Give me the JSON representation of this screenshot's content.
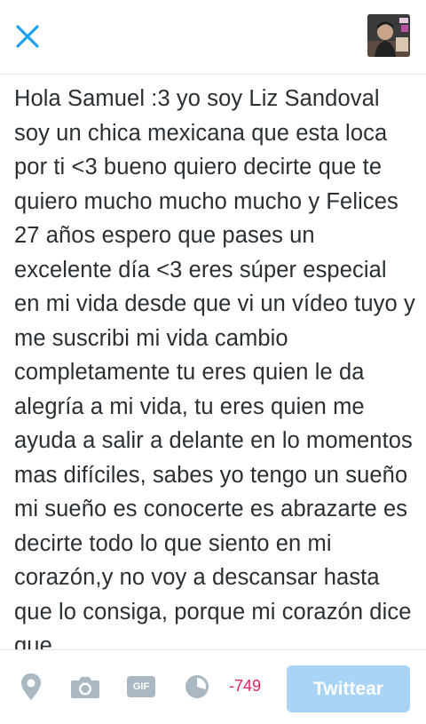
{
  "header": {
    "close_icon": "close-icon",
    "avatar_icon": "user-avatar"
  },
  "compose": {
    "text": "Hola Samuel :3 yo soy Liz Sandoval soy un chica mexicana que esta loca por ti <3 bueno quiero decirte que te quiero mucho mucho mucho y Felices 27 años espero que pases un excelente día <3 eres súper especial en mi vida desde que vi un vídeo tuyo y me suscribi mi vida cambio completamente tu eres quien le da alegría a mi vida, tu eres quien me ayuda a salir a delante en lo momentos mas difíciles, sabes yo tengo un sueño mi sueño es conocerte es abrazarte es decirte todo lo que siento en mi corazón,y no voy a descansar hasta que lo consiga, porque mi corazón dice que"
  },
  "toolbar": {
    "icons": [
      "location-pin-icon",
      "camera-icon",
      "gif-icon",
      "poll-icon"
    ],
    "gif_label": "GIF",
    "char_count": "-749",
    "tweet_label": "Twittear"
  },
  "colors": {
    "accent": "#1da1f2",
    "button_disabled": "#a9d4f5",
    "over_limit": "#e0245e",
    "icon_gray": "#aab8c2"
  }
}
